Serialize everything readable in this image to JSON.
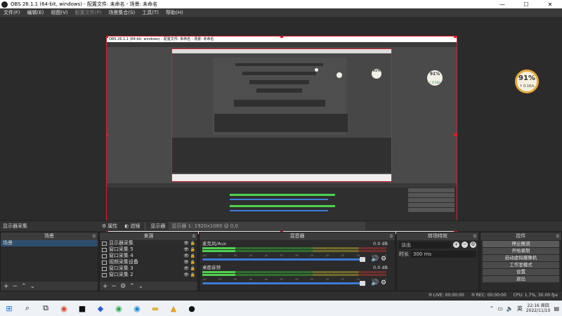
{
  "window": {
    "title": "OBS 26.1.1 (64-bit, windows) - 配置文件: 未命名 - 场景: 未命名",
    "controls": [
      "—",
      "☐",
      "✕"
    ]
  },
  "menu": [
    "文件(F)",
    "编辑(E)",
    "视图(V)",
    "配置文件(P)",
    "场景集合(S)",
    "工具(T)",
    "帮助(H)"
  ],
  "preview": {
    "nested_title": "OBS 26.1.1 (64-bit, windows) - 配置文件: 未命名 - 场景: 未命名",
    "gauge": {
      "percent": "91%",
      "speed": "↑ 0.1K/s"
    },
    "small_gauge": {
      "percent": "91%",
      "speed": "↑ 0.1K/s"
    }
  },
  "context_bar": {
    "source_label": "显示器采集",
    "properties": "属性",
    "filters": "滤镜",
    "display_label": "显示器",
    "display_value": "显示器 1: 1920x1080 @ 0,0"
  },
  "scenes": {
    "header": "场景",
    "items": [
      "场景"
    ]
  },
  "sources": {
    "header": "来源",
    "items": [
      {
        "name": "显示器采集",
        "icon": "monitor-icon"
      },
      {
        "name": "窗口采集 5",
        "icon": "window-icon"
      },
      {
        "name": "窗口采集 4",
        "icon": "window-icon"
      },
      {
        "name": "视频采集设备",
        "icon": "camera-icon"
      },
      {
        "name": "窗口采集 3",
        "icon": "window-icon"
      },
      {
        "name": "窗口采集 2",
        "icon": "window-icon"
      }
    ]
  },
  "mixer": {
    "header": "混音器",
    "channels": [
      {
        "name": "麦克风/Aux",
        "db": "0.0 dB",
        "level": 0.18
      },
      {
        "name": "桌面音频",
        "db": "0.0 dB",
        "level": 0.18
      }
    ],
    "ticks": [
      "-60",
      "-55",
      "-50",
      "-45",
      "-40",
      "-35",
      "-30",
      "-25",
      "-20",
      "-15",
      "-10",
      "-5",
      "0"
    ]
  },
  "transitions": {
    "header": "转场特效",
    "type": "淡出",
    "duration_label": "时长",
    "duration_value": "300 ms"
  },
  "controls": {
    "header": "控件",
    "buttons": [
      "停止推流",
      "开始录制",
      "启动虚拟摄像机",
      "工作室模式",
      "设置",
      "退出"
    ]
  },
  "status": {
    "live": "LIVE: 00:00:00",
    "rec": "REC: 00:00:00",
    "cpu": "CPU: 1.7%, 30.00 fps"
  },
  "taskbar": {
    "time": "22:16 周四",
    "date": "2022/11/10",
    "lang": "英"
  },
  "colors": {
    "accent": "#d9202c",
    "selection": "#2f4d6e",
    "slider": "#3b7dd8"
  }
}
